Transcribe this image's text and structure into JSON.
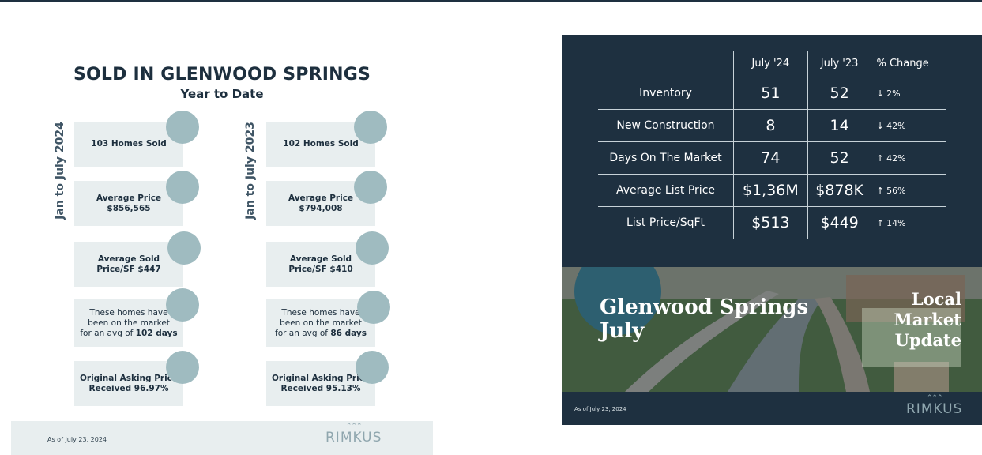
{
  "left": {
    "title": "SOLD IN GLENWOOD SPRINGS",
    "subtitle": "Year to Date",
    "period_2024": "Jan to July 2024",
    "period_2023": "Jan to July 2023",
    "col2024": [
      {
        "line1": "103 Homes Sold"
      },
      {
        "line1": "Average Price",
        "line2": "$856,565"
      },
      {
        "line1": "Average Sold",
        "line2": "Price/SF $447"
      },
      {
        "pre1": "These homes have",
        "pre2": "been on the market",
        "pre3": "for an avg of ",
        "strong": "102 days"
      },
      {
        "line1": "Original Asking Price",
        "line2": "Received  96.97%"
      }
    ],
    "col2023": [
      {
        "line1": "102 Homes Sold"
      },
      {
        "line1": "Average Price",
        "line2": "$794,008"
      },
      {
        "line1": "Average Sold",
        "line2": "Price/SF $410"
      },
      {
        "pre1": "These homes have",
        "pre2": "been on the market",
        "pre3": "for an avg of ",
        "strong": "86 days"
      },
      {
        "line1": "Original Asking Price",
        "line2": "Received  95.13%"
      }
    ],
    "footer_date": "As of July 23, 2024",
    "logo": "RIMKUS"
  },
  "right": {
    "table": {
      "headers": [
        "",
        "July '24",
        "July '23",
        "% Change"
      ],
      "rows": [
        {
          "label": "Inventory",
          "v24": "51",
          "v23": "52",
          "change": "↓ 2%"
        },
        {
          "label": "New Construction",
          "v24": "8",
          "v23": "14",
          "change": "↓ 42%"
        },
        {
          "label": "Days On The Market",
          "v24": "74",
          "v23": "52",
          "change": "↑ 42%"
        },
        {
          "label": "Average List Price",
          "v24": "$1,36M",
          "v23": "$878K",
          "change": "↑ 56%"
        },
        {
          "label": "List Price/SqFt",
          "v24": "$513",
          "v23": "$449",
          "change": "↑ 14%"
        }
      ]
    },
    "photo_title_line1": "Glenwood Springs",
    "photo_title_line2": "July",
    "local_line1": "Local",
    "local_line2": "Market",
    "local_line3": "Update",
    "footer_date": "As of July 23, 2024",
    "logo": "RIMKUS"
  },
  "colors": {
    "navy": "#1e3040",
    "card": "#e8eeef",
    "dot": "#9fbbc0",
    "accent_teal": "#2d5f70"
  }
}
